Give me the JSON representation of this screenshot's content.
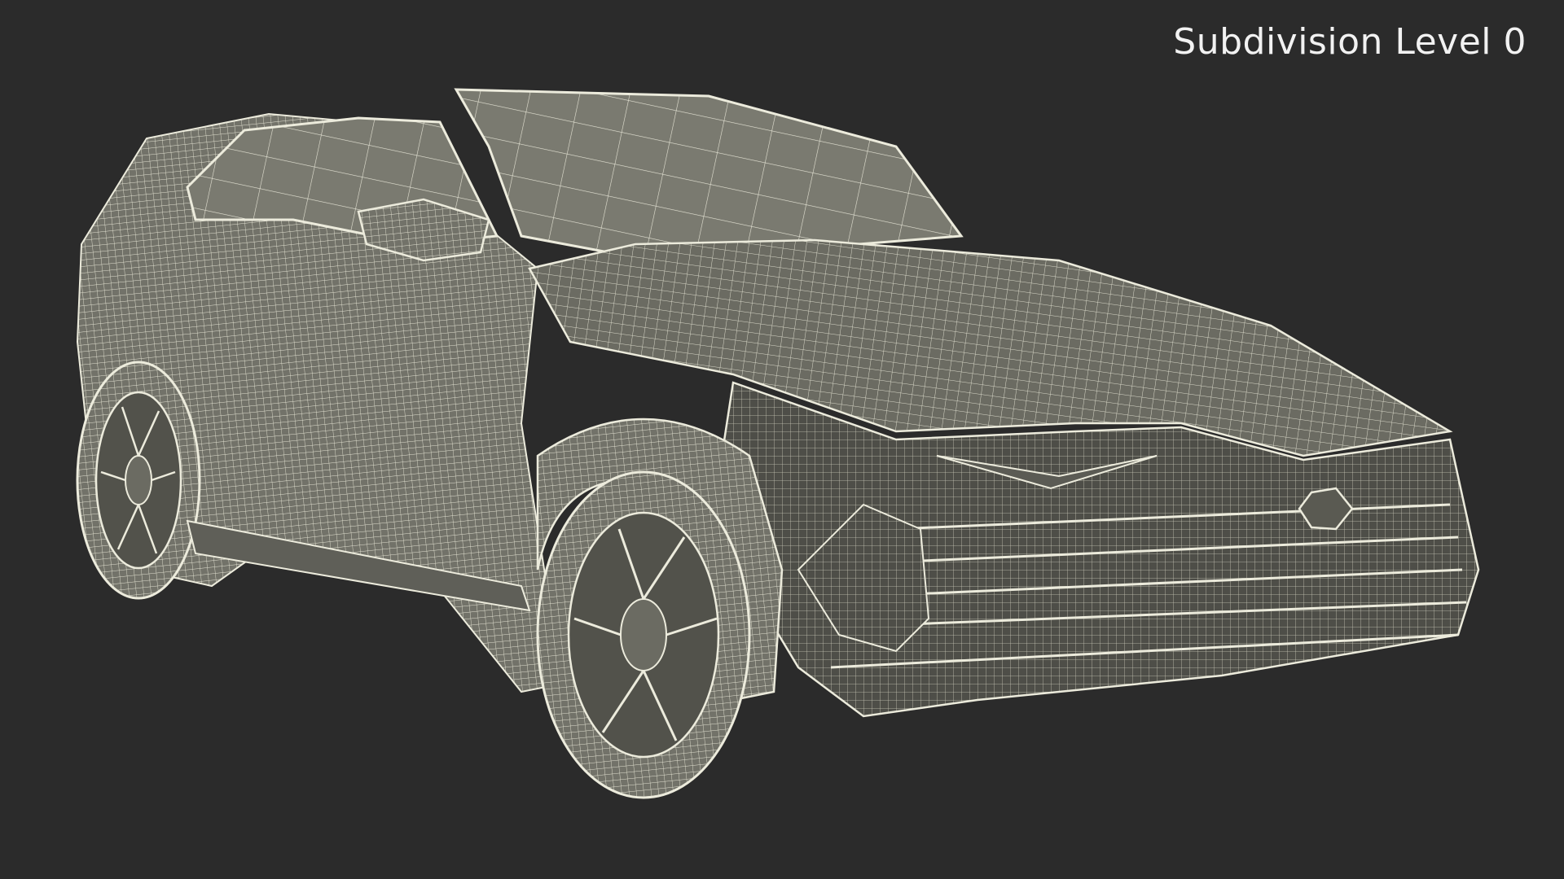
{
  "viewport": {
    "label": "Subdivision Level 0",
    "background_color": "#2b2b2b",
    "mesh_fill_color": "#6b6b62",
    "wire_color": "#ecebdc"
  },
  "model": {
    "icon": "car-wireframe-icon"
  }
}
